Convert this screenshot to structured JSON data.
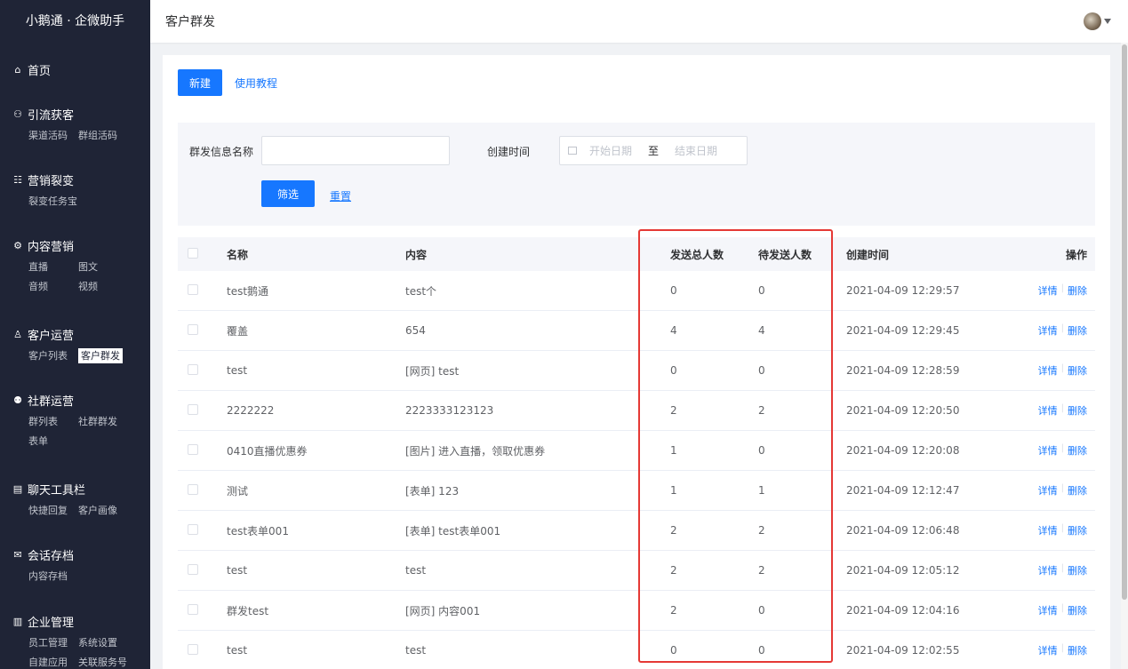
{
  "app": {
    "brand": "小鹅通 · 企微助手"
  },
  "header": {
    "title": "客户群发"
  },
  "sidebar": {
    "groups": [
      {
        "label": "首页",
        "icon": "home-icon",
        "subs": []
      },
      {
        "label": "引流获客",
        "icon": "network-icon",
        "subs": [
          "渠道活码",
          "群组活码"
        ]
      },
      {
        "label": "营销裂变",
        "icon": "sitemap-icon",
        "subs": [
          "裂变任务宝"
        ]
      },
      {
        "label": "内容营销",
        "icon": "settings-icon",
        "subs": [
          "直播",
          "图文",
          "音频",
          "视频"
        ]
      },
      {
        "label": "客户运营",
        "icon": "user-icon",
        "subs": [
          "客户列表",
          "客户群发"
        ]
      },
      {
        "label": "社群运营",
        "icon": "group-icon",
        "subs": [
          "群列表",
          "社群群发",
          "表单"
        ]
      },
      {
        "label": "聊天工具栏",
        "icon": "chat-tool-icon",
        "subs": [
          "快捷回复",
          "客户画像"
        ]
      },
      {
        "label": "会话存档",
        "icon": "archive-icon",
        "subs": [
          "内容存档"
        ]
      },
      {
        "label": "企业管理",
        "icon": "building-icon",
        "subs": [
          "员工管理",
          "系统设置",
          "自建应用",
          "关联服务号"
        ]
      }
    ],
    "active_sub": "客户群发"
  },
  "toolbar": {
    "new_label": "新建",
    "tutorial_label": "使用教程"
  },
  "filter": {
    "name_label": "群发信息名称",
    "name_value": "",
    "time_label": "创建时间",
    "start_placeholder": "开始日期",
    "range_sep": "至",
    "end_placeholder": "结束日期",
    "filter_btn": "筛选",
    "reset_link": "重置"
  },
  "table": {
    "headers": {
      "name": "名称",
      "content": "内容",
      "total": "发送总人数",
      "pending": "待发送人数",
      "time": "创建时间",
      "ops": "操作"
    },
    "op_detail": "详情",
    "op_delete": "删除",
    "rows": [
      {
        "name": "test鹅通",
        "content": "test个",
        "total": "0",
        "pending": "0",
        "time": "2021-04-09 12:29:57"
      },
      {
        "name": "覆盖",
        "content": "654",
        "total": "4",
        "pending": "4",
        "time": "2021-04-09 12:29:45"
      },
      {
        "name": "test",
        "content": "[网页] test",
        "total": "0",
        "pending": "0",
        "time": "2021-04-09 12:28:59"
      },
      {
        "name": "2222222",
        "content": "2223333123123",
        "total": "2",
        "pending": "2",
        "time": "2021-04-09 12:20:50"
      },
      {
        "name": "0410直播优惠券",
        "content": "[图片] 进入直播，领取优惠券",
        "total": "1",
        "pending": "0",
        "time": "2021-04-09 12:20:08"
      },
      {
        "name": "测试",
        "content": "[表单] 123",
        "total": "1",
        "pending": "1",
        "time": "2021-04-09 12:12:47"
      },
      {
        "name": "test表单001",
        "content": "[表单] test表单001",
        "total": "2",
        "pending": "2",
        "time": "2021-04-09 12:06:48"
      },
      {
        "name": "test",
        "content": "test",
        "total": "2",
        "pending": "2",
        "time": "2021-04-09 12:05:12"
      },
      {
        "name": "群发test",
        "content": "[网页] 内容001",
        "total": "2",
        "pending": "0",
        "time": "2021-04-09 12:04:16"
      },
      {
        "name": "test",
        "content": "test",
        "total": "0",
        "pending": "0",
        "time": "2021-04-09 12:02:55"
      }
    ]
  },
  "colors": {
    "primary": "#1677ff",
    "sidebar_bg": "#1f2436",
    "highlight": "#e53935"
  }
}
